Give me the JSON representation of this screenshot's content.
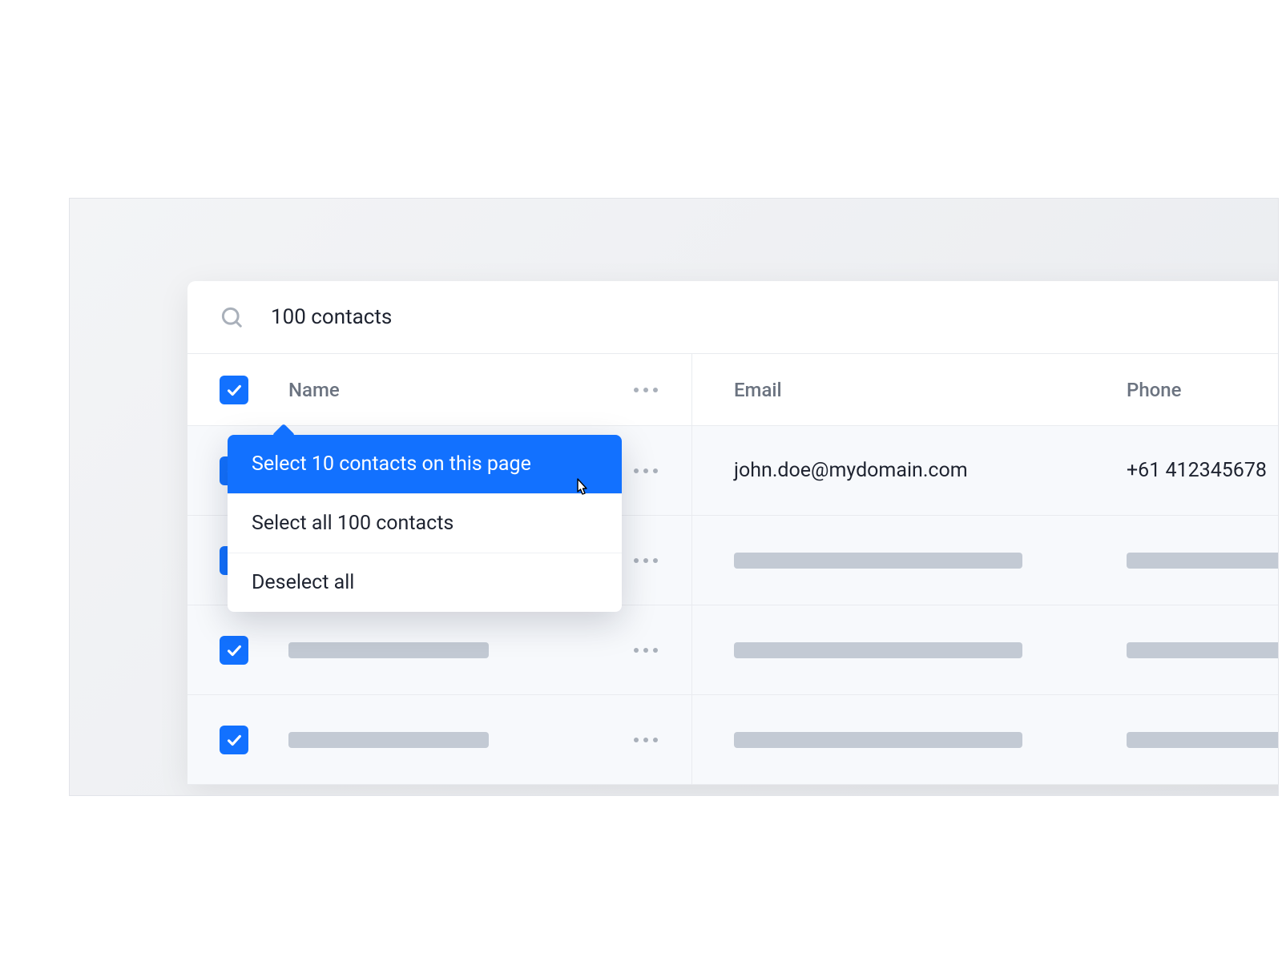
{
  "search": {
    "count_label": "100 contacts"
  },
  "columns": {
    "name": "Name",
    "email": "Email",
    "phone": "Phone"
  },
  "rows": [
    {
      "name": "",
      "email": "john.doe@mydomain.com",
      "phone": "+61 412345678"
    },
    {
      "name": "",
      "email": "",
      "phone": ""
    },
    {
      "name": "",
      "email": "",
      "phone": ""
    },
    {
      "name": "",
      "email": "",
      "phone": ""
    }
  ],
  "dropdown": {
    "items": [
      "Select 10 contacts on this page",
      "Select all 100 contacts",
      "Deselect all"
    ],
    "active_index": 0
  },
  "colors": {
    "accent": "#1271ff",
    "text": "#1e2330",
    "muted": "#6b7380",
    "placeholder": "#c3cad4"
  }
}
